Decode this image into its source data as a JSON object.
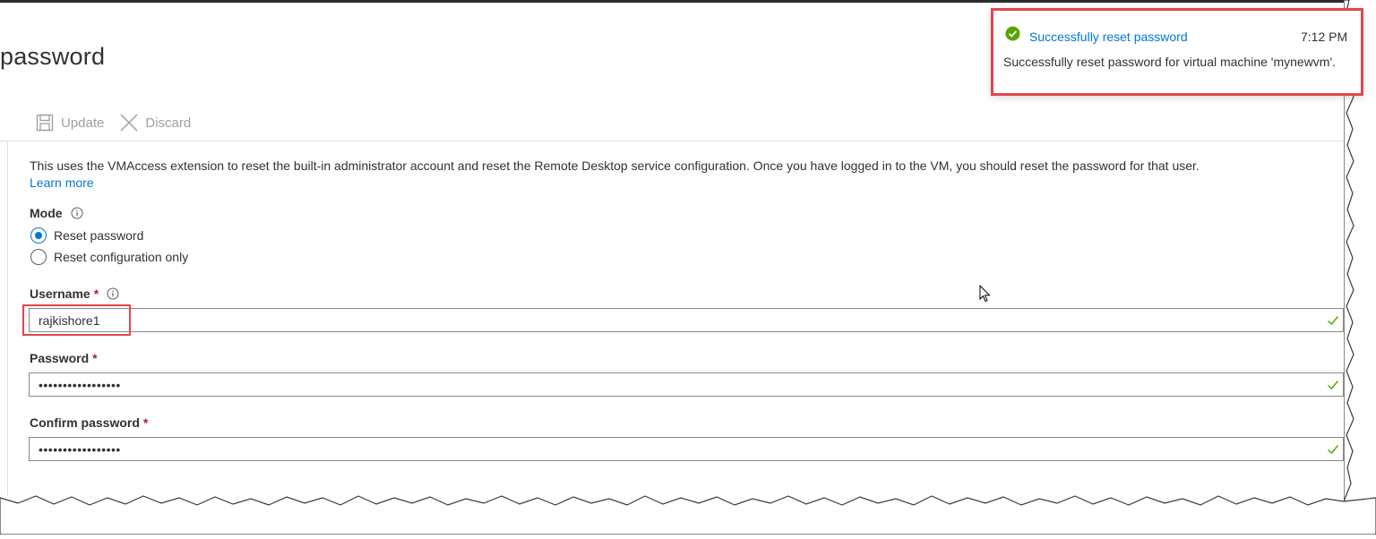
{
  "page": {
    "title": "password"
  },
  "toolbar": {
    "update_label": "Update",
    "discard_label": "Discard"
  },
  "description": {
    "text": "This uses the VMAccess extension to reset the built-in administrator account and reset the Remote Desktop service configuration. Once you have logged in to the VM, you should reset the password for that user.",
    "link_label": "Learn more"
  },
  "mode": {
    "label": "Mode",
    "options": [
      {
        "label": "Reset password",
        "selected": true
      },
      {
        "label": "Reset configuration only",
        "selected": false
      }
    ]
  },
  "username": {
    "label": "Username",
    "required_mark": "*",
    "value": "rajkishore1"
  },
  "password": {
    "label": "Password",
    "required_mark": "*",
    "value": "•••••••••••••••••"
  },
  "confirm_password": {
    "label": "Confirm password",
    "required_mark": "*",
    "value": "•••••••••••••••••"
  },
  "notification": {
    "title": "Successfully reset password",
    "time": "7:12 PM",
    "message": "Successfully reset password for virtual machine 'mynewvm'."
  },
  "colors": {
    "accent": "#0078d4",
    "success": "#57a300",
    "highlight": "#e2474c",
    "required": "#a4262c"
  },
  "icons": [
    "save-icon",
    "discard-icon",
    "info-icon",
    "checkmark-icon",
    "success-icon",
    "cursor-icon"
  ]
}
